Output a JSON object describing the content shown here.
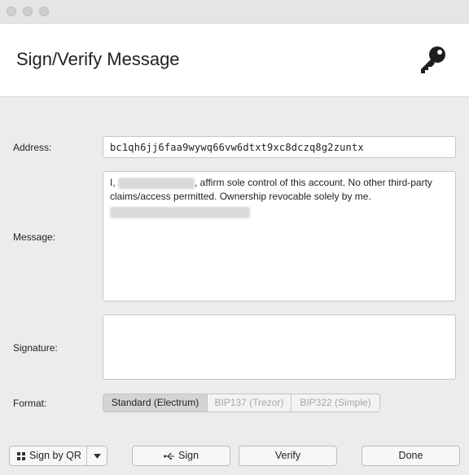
{
  "window": {
    "title": "Sign/Verify Message"
  },
  "icons": {
    "header": "key-icon",
    "qr": "qr-grid-icon",
    "usb": "usb-icon",
    "dropdown": "chevron-down-icon"
  },
  "address": {
    "label": "Address:",
    "value": "bc1qh6jj6faa9wywq66vw6dtxt9xc8dczq8g2zuntx"
  },
  "message": {
    "label": "Message:",
    "prefix": "I, ",
    "body": ", affirm sole control of this account. No other third-party claims/access permitted. Ownership revocable solely by me."
  },
  "signature": {
    "label": "Signature:",
    "value": ""
  },
  "format": {
    "label": "Format:",
    "options": [
      "Standard (Electrum)",
      "BIP137 (Trezor)",
      "BIP322 (Simple)"
    ],
    "selected": "Standard (Electrum)"
  },
  "buttons": {
    "sign_by_qr": "Sign by QR",
    "sign": "Sign",
    "verify": "Verify",
    "done": "Done"
  }
}
